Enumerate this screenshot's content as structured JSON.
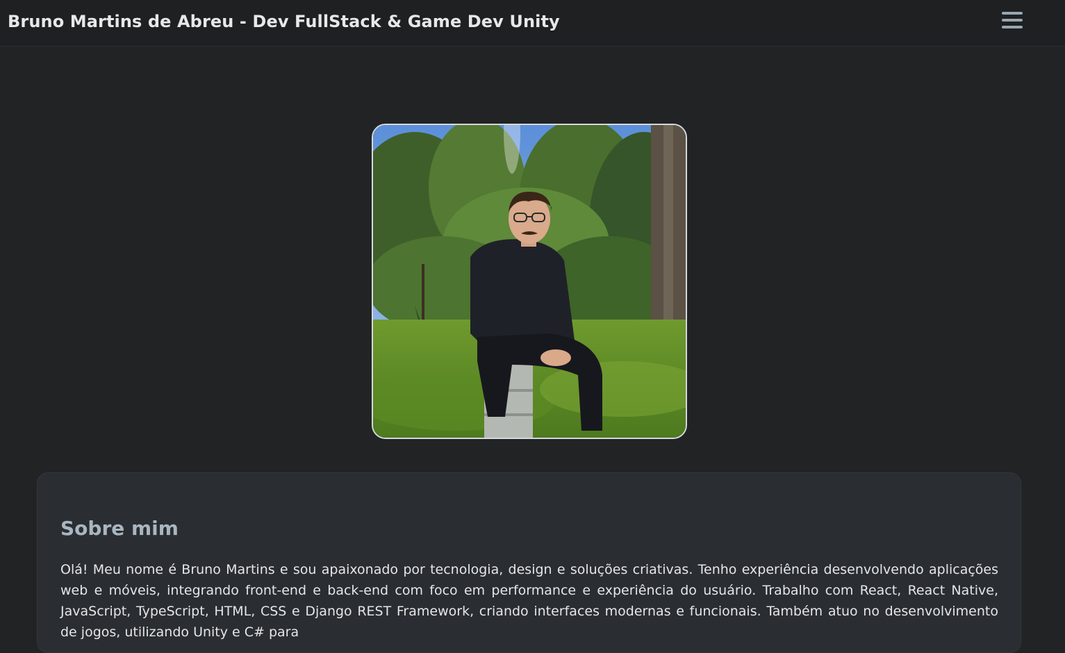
{
  "header": {
    "title": "Bruno Martins de Abreu - Dev FullStack & Game Dev Unity",
    "menu_icon": "hamburger-menu-icon"
  },
  "profile": {
    "photo_description_icon": "profile-photo"
  },
  "about": {
    "heading": "Sobre mim",
    "text": "Olá! Meu nome é Bruno Martins e sou apaixonado por tecnologia, design e soluções criativas. Tenho experiência desenvolvendo aplicações web e móveis, integrando front-end e back-end com foco em performance e experiência do usuário. Trabalho com React, React Native, JavaScript, TypeScript, HTML, CSS e Django REST Framework, criando interfaces modernas e funcionais. Também atuo no desenvolvimento de jogos, utilizando Unity e C# para"
  },
  "colors": {
    "background": "#212325",
    "navbar": "#1e2022",
    "card": "#2a2d31",
    "heading_accent": "#a9b6c1",
    "menu_icon": "#9aa6b0"
  }
}
